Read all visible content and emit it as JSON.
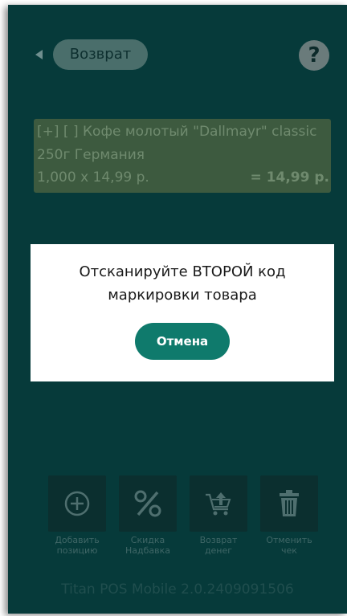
{
  "header": {
    "back_label": "Возврат",
    "help_label": "?"
  },
  "item": {
    "name": "[+] [ ] Кофе молотый \"Dallmayr\" classic 250г Германия",
    "qty_price": "1,000 x 14,99 р.",
    "total": "= 14,99 р."
  },
  "dialog": {
    "message_line1": "Отсканируйте ВТОРОЙ код",
    "message_line2": "маркировки товара",
    "cancel_label": "Отмена"
  },
  "actions": [
    {
      "label": "Добавить позицию",
      "icon": "plus-circle-icon"
    },
    {
      "label": "Скидка Надбавка",
      "icon": "percent-icon"
    },
    {
      "label": "Возврат денег",
      "icon": "return-cart-icon"
    },
    {
      "label": "Отменить чек",
      "icon": "trash-icon"
    }
  ],
  "footer": {
    "version": "Titan POS Mobile 2.0.2409091506"
  },
  "colors": {
    "background": "#063a3a",
    "accent": "#0f7a6c",
    "dialog": "#ffffff"
  }
}
